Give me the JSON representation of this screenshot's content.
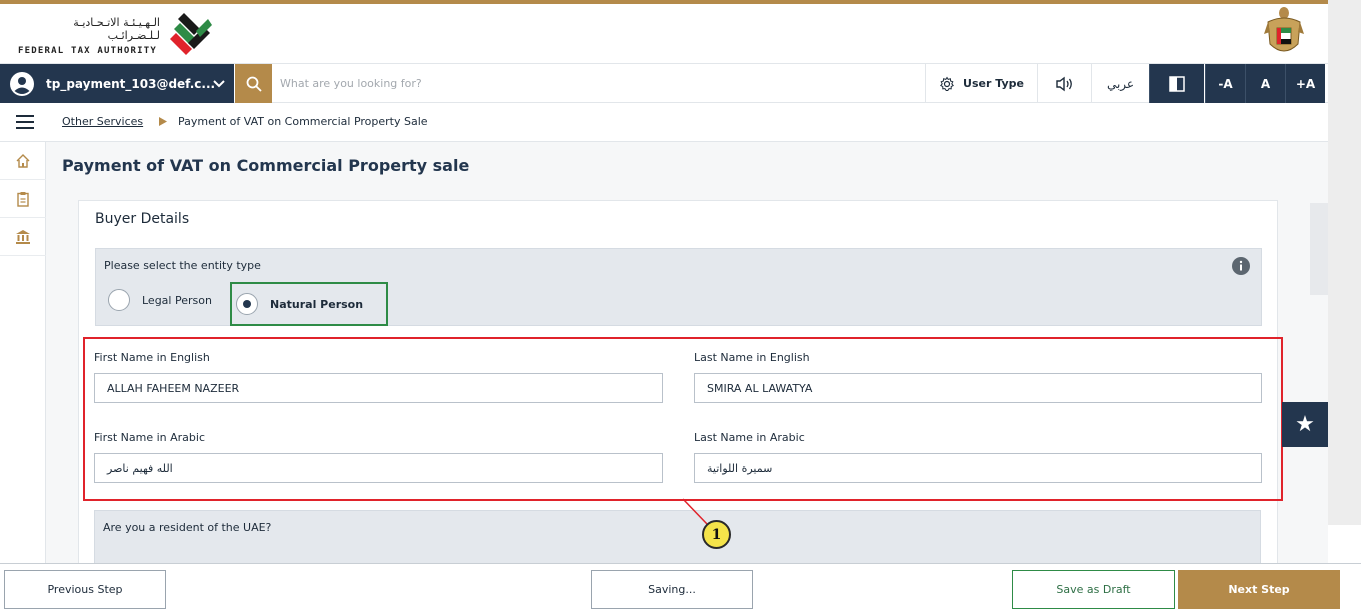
{
  "header": {
    "logo_ar": "الـهـيـئـة الاتـحـاديـة لـلـضـرائـب",
    "logo_en": "FEDERAL TAX AUTHORITY"
  },
  "navbar": {
    "user_email": "tp_payment_103@def.c...",
    "search_placeholder": "What are you looking for?",
    "user_type": "User Type",
    "arabic": "عربي",
    "font_decrease": "-A",
    "font_normal": "A",
    "font_increase": "+A"
  },
  "breadcrumb": {
    "parent": "Other Services",
    "current": "Payment of VAT on Commercial Property Sale"
  },
  "page": {
    "title": "Payment of VAT on Commercial Property sale"
  },
  "form": {
    "section_title": "Buyer Details",
    "entity_prompt": "Please select the entity type",
    "entity_options": [
      "Legal Person",
      "Natural Person"
    ],
    "entity_selected": "Natural Person",
    "first_name_en_label": "First Name in English",
    "first_name_en_value": "ALLAH FAHEEM NAZEER",
    "last_name_en_label": "Last Name in English",
    "last_name_en_value": "SMIRA AL LAWATYA",
    "first_name_ar_label": "First Name in Arabic",
    "first_name_ar_value": "الله فهيم ناصر",
    "last_name_ar_label": "Last Name in Arabic",
    "last_name_ar_value": "سميرة اللواتية",
    "resident_prompt": "Are you a resident of the UAE?"
  },
  "annotation": {
    "marker": "1"
  },
  "footer": {
    "previous": "Previous Step",
    "saving": "Saving...",
    "save_draft": "Save as Draft",
    "next": "Next Step"
  },
  "colors": {
    "navy": "#23364e",
    "gold": "#b48a4a",
    "green": "#2e8b46",
    "highlight_red": "#e0232b"
  }
}
